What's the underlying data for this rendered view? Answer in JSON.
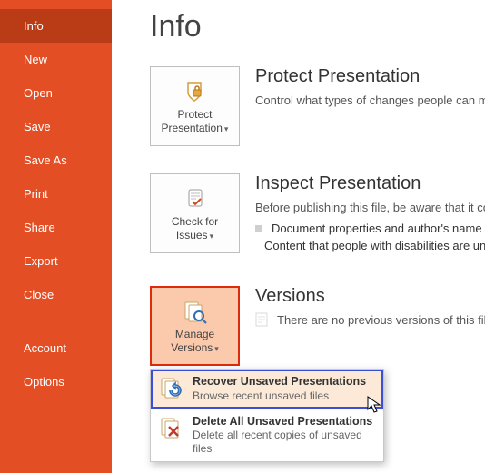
{
  "sidebar": {
    "items": [
      {
        "label": "Info",
        "selected": true
      },
      {
        "label": "New",
        "selected": false
      },
      {
        "label": "Open",
        "selected": false
      },
      {
        "label": "Save",
        "selected": false
      },
      {
        "label": "Save As",
        "selected": false
      },
      {
        "label": "Print",
        "selected": false
      },
      {
        "label": "Share",
        "selected": false
      },
      {
        "label": "Export",
        "selected": false
      },
      {
        "label": "Close",
        "selected": false
      }
    ],
    "bottom": [
      {
        "label": "Account"
      },
      {
        "label": "Options"
      }
    ]
  },
  "page_title": "Info",
  "sections": {
    "protect": {
      "box_label_1": "Protect",
      "box_label_2": "Presentation",
      "title": "Protect Presentation",
      "desc": "Control what types of changes people can make"
    },
    "inspect": {
      "box_label_1": "Check for",
      "box_label_2": "Issues",
      "title": "Inspect Presentation",
      "desc": "Before publishing this file, be aware that it conta",
      "bullets": [
        "Document properties and author's name",
        "Content that people with disabilities are un"
      ]
    },
    "versions": {
      "box_label_1": "Manage",
      "box_label_2": "Versions",
      "title": "Versions",
      "empty": "There are no previous versions of this file."
    }
  },
  "menu": {
    "recover": {
      "title": "Recover Unsaved Presentations",
      "sub": "Browse recent unsaved files"
    },
    "delete": {
      "title": "Delete All Unsaved Presentations",
      "sub": "Delete all recent copies of unsaved files"
    }
  }
}
